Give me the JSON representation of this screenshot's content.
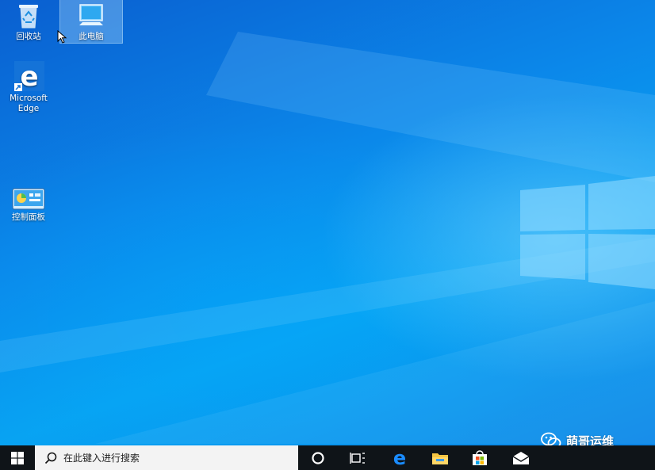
{
  "desktop": {
    "icons": [
      {
        "label": "回收站",
        "icon": "recycle-bin-icon"
      },
      {
        "label": "此电脑",
        "icon": "this-pc-icon",
        "selected": true
      },
      {
        "label": "Microsoft Edge",
        "icon": "edge-icon"
      },
      {
        "label": "控制面板",
        "icon": "control-panel-icon"
      }
    ]
  },
  "taskbar": {
    "start_icon": "windows-start-icon",
    "search": {
      "placeholder": "在此键入进行搜索",
      "icon": "search-icon"
    },
    "buttons": [
      {
        "icon": "cortana-icon"
      },
      {
        "icon": "task-view-icon"
      },
      {
        "icon": "edge-icon"
      },
      {
        "icon": "file-explorer-icon"
      },
      {
        "icon": "store-icon"
      },
      {
        "icon": "mail-icon"
      }
    ]
  },
  "watermark": {
    "text": "萌哥运维",
    "icon": "wechat-icon"
  },
  "colors": {
    "desktop": "#0a7fe0",
    "taskbar": "#0f1418",
    "search_bg": "#f3f3f3"
  }
}
